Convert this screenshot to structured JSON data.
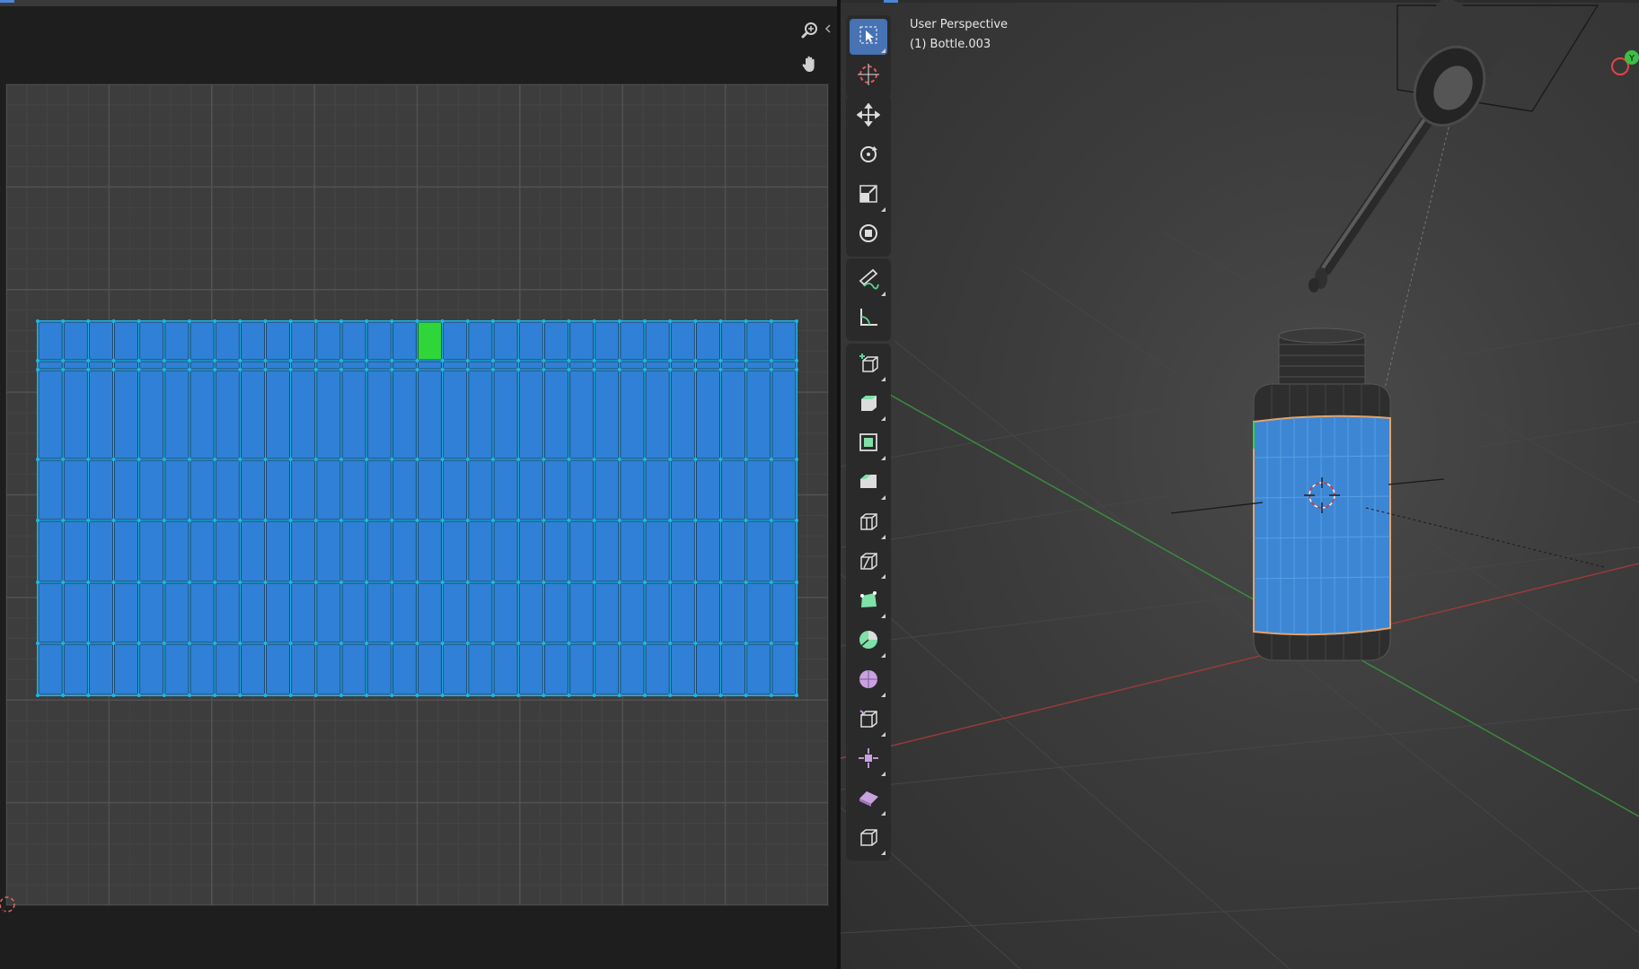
{
  "viewport": {
    "view_name": "User Perspective",
    "object_name": "(1) Bottle.003"
  },
  "uv_editor": {
    "uv_columns": 30,
    "uv_rows": 6,
    "selected_face": {
      "column": 15,
      "row": 0
    },
    "colors": {
      "canvas": "#3d3d3d",
      "grid_major": "#525252",
      "grid_minor": "#454545",
      "face_fill": "#2f80d6",
      "face_edge": "#1fb6e6",
      "selected_face": "#2fd63a"
    }
  },
  "toolbar": {
    "groups": [
      {
        "tools": [
          "select-box-icon",
          "cursor-icon"
        ]
      },
      {
        "tools": [
          "move-icon",
          "rotate-icon",
          "scale-icon",
          "transform-icon"
        ]
      },
      {
        "tools": [
          "annotate-icon",
          "measure-icon"
        ]
      },
      {
        "tools": [
          "add-cube-icon",
          "extrude-region-icon",
          "inset-faces-icon",
          "bevel-icon",
          "loop-cut-icon",
          "knife-icon",
          "poly-build-icon",
          "spin-icon",
          "smooth-icon",
          "edge-slide-icon",
          "shrink-fatten-icon",
          "shear-icon",
          "rip-region-icon"
        ]
      }
    ],
    "active_tool": "select-box-icon"
  },
  "gizmo": {
    "y_label": "Y"
  }
}
